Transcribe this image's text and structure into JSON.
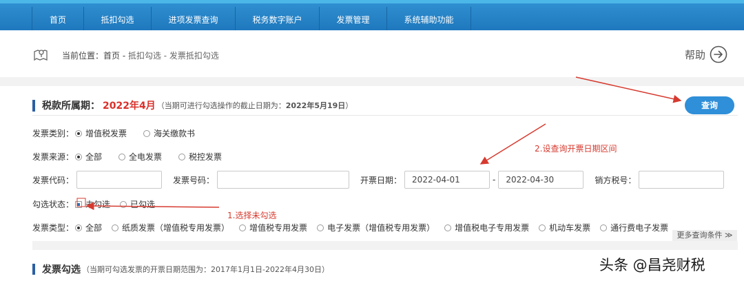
{
  "nav": {
    "items": [
      "首页",
      "抵扣勾选",
      "进项发票查询",
      "税务数字账户",
      "发票管理",
      "系统辅助功能"
    ]
  },
  "breadcrumb": {
    "prefix": "当前位置：首页 - ",
    "current": "抵扣勾选 - 发票抵扣勾选",
    "icon": "location-map-icon"
  },
  "help": {
    "label": "帮助",
    "icon": "arrow-right-circle-icon"
  },
  "tax_period": {
    "title": "税款所属期：",
    "value": "2022年4月",
    "note_prefix": "（当期可进行勾选操作的截止日期为：",
    "note_date": "2022年5月19日",
    "note_suffix": "）"
  },
  "query_button": "查询",
  "filters": {
    "invoice_category": {
      "label": "发票类别：",
      "options": [
        "增值税发票",
        "海关缴款书"
      ],
      "selected": 0
    },
    "invoice_source": {
      "label": "发票来源：",
      "options": [
        "全部",
        "全电发票",
        "税控发票"
      ],
      "selected": 0
    },
    "invoice_code": {
      "label": "发票代码：",
      "value": ""
    },
    "invoice_number": {
      "label": "发票号码：",
      "value": ""
    },
    "issue_date": {
      "label": "开票日期：",
      "from": "2022-04-01",
      "sep": "-",
      "to": "2022-04-30"
    },
    "seller_tax_id": {
      "label": "销方税号：",
      "value": ""
    },
    "check_status": {
      "label": "勾选状态：",
      "options": [
        "未勾选",
        "已勾选"
      ],
      "selected": 0
    },
    "invoice_type": {
      "label": "发票类型：",
      "options": [
        "全部",
        "纸质发票（增值税专用发票）",
        "增值税专用发票",
        "电子发票（增值税专用发票）",
        "增值税电子专用发票",
        "机动车发票",
        "通行费电子发票"
      ],
      "selected": 0
    }
  },
  "more_conditions": "更多查询条件 ≫",
  "annotations": {
    "step1": "1.选择未勾选",
    "step2": "2.设查询开票日期区间"
  },
  "section2": {
    "title": "发票勾选",
    "note": "（当期可勾选发票的开票日期范围为：2017年1月1日-2022年4月30日）"
  },
  "watermark": "头条 @昌尧财税",
  "colors": {
    "nav": "#1f78bd",
    "accent": "#2f8fd8",
    "period": "#d9302b",
    "annotation": "#d63a2f"
  }
}
